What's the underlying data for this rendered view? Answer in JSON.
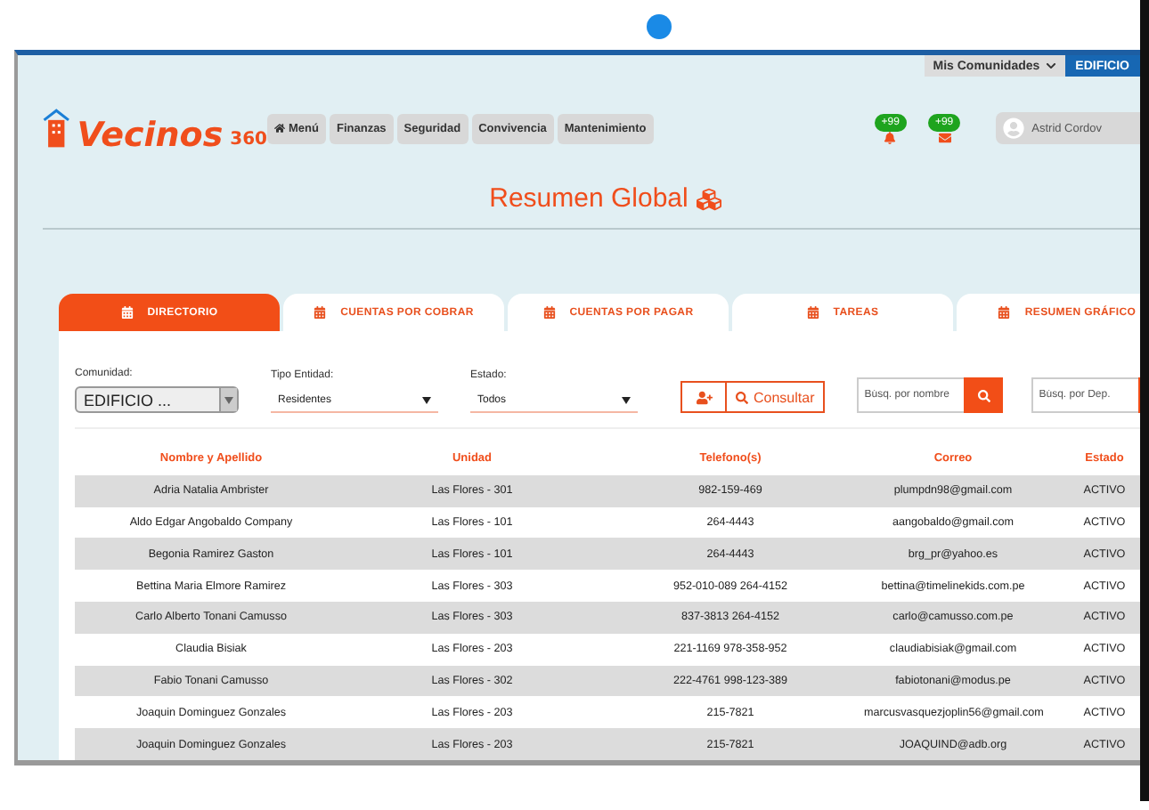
{
  "top_bar": {
    "communities_menu": "Mis Comunidades",
    "building_tab": "EDIFICIO"
  },
  "header": {
    "logo_text": "Vecinos",
    "logo_number": "360",
    "nav": [
      {
        "label": "Menú",
        "kind": "home"
      },
      {
        "label": "Finanzas",
        "kind": "plain"
      },
      {
        "label": "Seguridad",
        "kind": "plain"
      },
      {
        "label": "Convivencia",
        "kind": "plain"
      },
      {
        "label": "Mantenimiento",
        "kind": "plain"
      }
    ],
    "notifications": [
      {
        "count": "+99",
        "kind": "bell"
      },
      {
        "count": "+99",
        "kind": "mail"
      }
    ],
    "user": "Astrid Cordov"
  },
  "page_title": "Resumen Global",
  "tabs": [
    {
      "label": "DIRECTORIO",
      "selected": true
    },
    {
      "label": "CUENTAS POR COBRAR",
      "selected": false
    },
    {
      "label": "CUENTAS POR PAGAR",
      "selected": false
    },
    {
      "label": "TAREAS",
      "selected": false
    },
    {
      "label": "RESUMEN GRÁFICO",
      "selected": false
    }
  ],
  "filters": {
    "comunidad": {
      "label": "Comunidad:",
      "value": "EDIFICIO ..."
    },
    "tipo_entidad": {
      "label": "Tipo Entidad:",
      "value": "Residentes"
    },
    "estado": {
      "label": "Estado:",
      "value": "Todos"
    },
    "consult_button": "Consultar",
    "search_name": {
      "placeholder": "Búsq. por nombre"
    },
    "search_dep": {
      "placeholder": "Búsq. por Dep."
    }
  },
  "table": {
    "columns": [
      "Nombre y Apellido",
      "Unidad",
      "Telefono(s)",
      "Correo",
      "Estado"
    ],
    "rows": [
      [
        "Adria Natalia Ambrister",
        "Las Flores - 301",
        "982-159-469",
        "plumpdn98@gmail.com",
        "ACTIVO"
      ],
      [
        "Aldo Edgar Angobaldo Company",
        "Las Flores - 101",
        "264-4443",
        "aangobaldo@gmail.com",
        "ACTIVO"
      ],
      [
        "Begonia Ramirez Gaston",
        "Las Flores - 101",
        "264-4443",
        "brg_pr@yahoo.es",
        "ACTIVO"
      ],
      [
        "Bettina Maria Elmore Ramirez",
        "Las Flores - 303",
        "952-010-089 264-4152",
        "bettina@timelinekids.com.pe",
        "ACTIVO"
      ],
      [
        "Carlo Alberto Tonani Camusso",
        "Las Flores - 303",
        "837-3813 264-4152",
        "carlo@camusso.com.pe",
        "ACTIVO"
      ],
      [
        "Claudia Bisiak",
        "Las Flores - 203",
        "221-1169 978-358-952",
        "claudiabisiak@gmail.com",
        "ACTIVO"
      ],
      [
        "Fabio Tonani Camusso",
        "Las Flores - 302",
        "222-4761 998-123-389",
        "fabiotonani@modus.pe",
        "ACTIVO"
      ],
      [
        "Joaquin Dominguez Gonzales",
        "Las Flores - 203",
        "215-7821",
        "marcusvasquezjoplin56@gmail.com",
        "ACTIVO"
      ],
      [
        "Joaquin Dominguez Gonzales",
        "Las Flores - 203",
        "215-7821",
        "JOAQUIND@adb.org",
        "ACTIVO"
      ]
    ]
  }
}
